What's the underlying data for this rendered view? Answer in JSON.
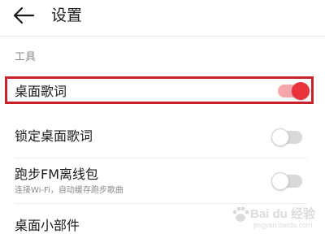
{
  "header": {
    "title": "设置",
    "back_icon": "arrow-left-icon"
  },
  "section": {
    "title": "工具"
  },
  "settings": [
    {
      "label": "桌面歌词",
      "sublabel": "",
      "toggle": "on",
      "highlighted": true
    },
    {
      "label": "锁定桌面歌词",
      "sublabel": "",
      "toggle": "off",
      "highlighted": false
    },
    {
      "label": "跑步FM离线包",
      "sublabel": "连接Wi-Fi，自动缓存跑步歌曲",
      "toggle": "off",
      "highlighted": false
    },
    {
      "label": "桌面小部件",
      "sublabel": "",
      "toggle": null,
      "highlighted": false
    }
  ],
  "watermark": {
    "brand": "Bai du 经验",
    "url": "jingyan.baidu.com"
  },
  "colors": {
    "accent": "#e8323c",
    "accent_track": "#f4a7ab",
    "highlight_border": "#c8202a",
    "section_text": "#8a8a8a"
  }
}
